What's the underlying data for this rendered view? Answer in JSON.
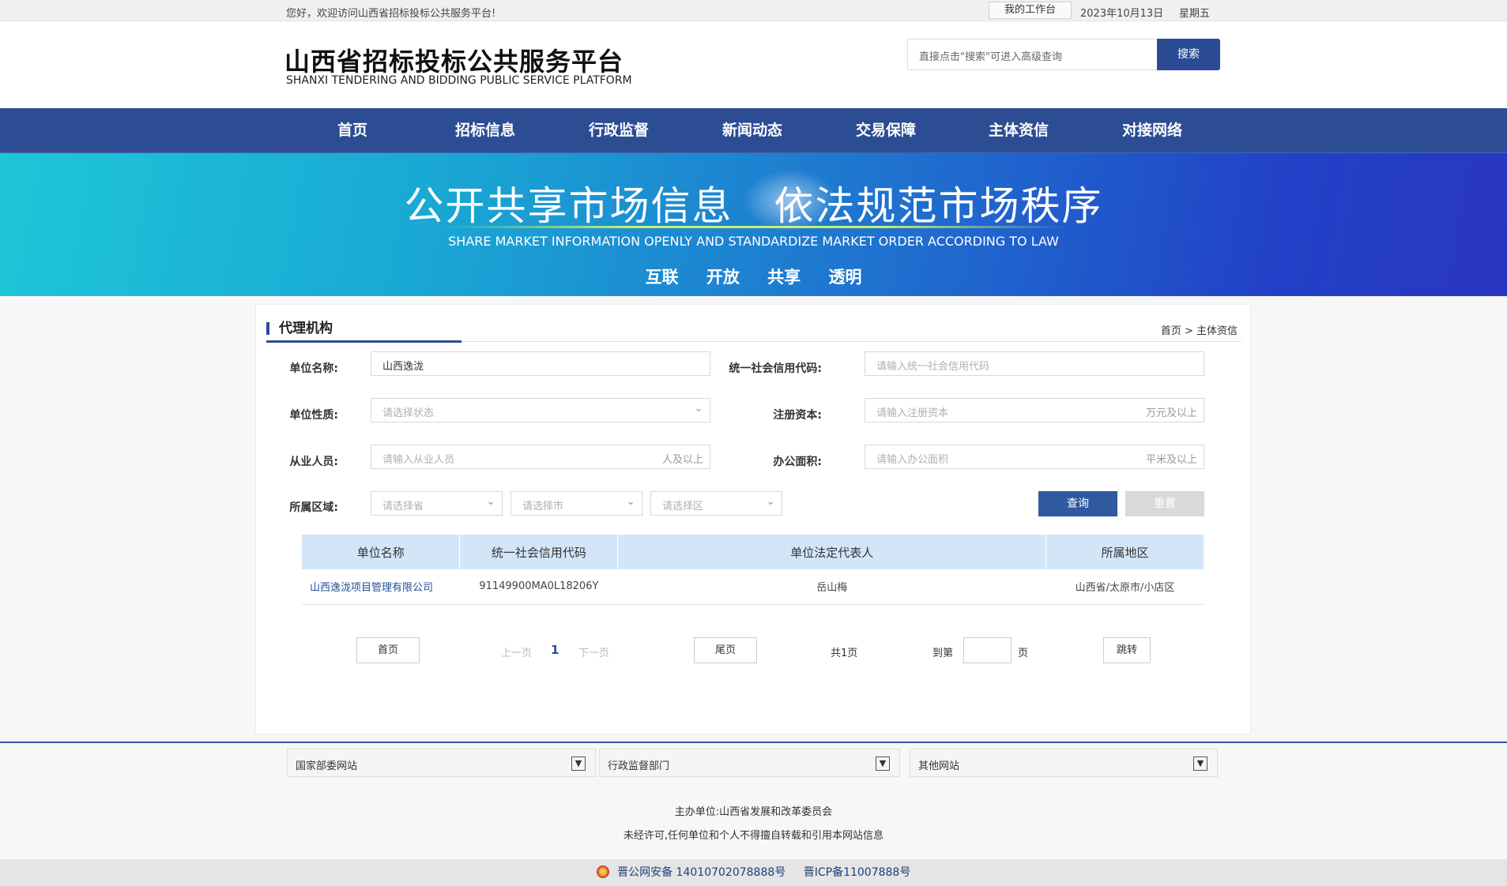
{
  "topbar": {
    "welcome": "您好，欢迎访问山西省招标投标公共服务平台!",
    "workbench": "我的工作台",
    "date": "2023年10月13日",
    "weekday": "星期五"
  },
  "header": {
    "logo_cn": "山西省招标投标公共服务平台",
    "logo_en": "SHANXI TENDERING AND BIDDING PUBLIC SERVICE PLATFORM",
    "search_placeholder": "直接点击\"搜索\"可进入高级查询",
    "search_button": "搜索"
  },
  "nav": [
    "首页",
    "招标信息",
    "行政监督",
    "新闻动态",
    "交易保障",
    "主体资信",
    "对接网络"
  ],
  "banner": {
    "slogan": "公开共享市场信息　依法规范市场秩序",
    "slogan_en": "SHARE MARKET INFORMATION OPENLY AND STANDARDIZE MARKET ORDER ACCORDING TO LAW",
    "tags": [
      "互联",
      "开放",
      "共享",
      "透明"
    ]
  },
  "panel": {
    "title": "代理机构",
    "breadcrumb": "首页 > 主体资信"
  },
  "form": {
    "unit_name_label": "单位名称:",
    "unit_name_value": "山西逸泷",
    "credit_code_label": "统一社会信用代码:",
    "credit_code_placeholder": "请输入统一社会信用代码",
    "nature_label": "单位性质:",
    "nature_placeholder": "请选择状态",
    "capital_label": "注册资本:",
    "capital_placeholder": "请输入注册资本",
    "capital_suffix": "万元及以上",
    "staff_label": "从业人员:",
    "staff_placeholder": "请输入从业人员",
    "staff_suffix": "人及以上",
    "area_label": "办公面积:",
    "area_placeholder": "请输入办公面积",
    "area_suffix": "平米及以上",
    "region_label": "所属区域:",
    "province_placeholder": "请选择省",
    "city_placeholder": "请选择市",
    "district_placeholder": "请选择区",
    "query_button": "查询",
    "reset_button": "重置"
  },
  "table": {
    "headers": [
      "单位名称",
      "统一社会信用代码",
      "单位法定代表人",
      "所属地区"
    ],
    "rows": [
      [
        "山西逸泷项目管理有限公司",
        "91149900MA0L18206Y",
        "岳山梅",
        "山西省/太原市/小店区"
      ]
    ]
  },
  "pagination": {
    "first": "首页",
    "prev": "上一页",
    "current": "1",
    "next": "下一页",
    "last": "尾页",
    "total": "共1页",
    "goto_label": "到第",
    "goto_unit": "页",
    "jump": "跳转"
  },
  "footer": {
    "selects": [
      "国家部委网站",
      "行政监督部门",
      "其他网站"
    ],
    "sponsor": "主办单位:山西省发展和改革委员会",
    "copyright": "未经许可,任何单位和个人不得擅自转载和引用本网站信息",
    "police_record": "晋公网安备 14010702078888号",
    "icp_record": "晋ICP备11007888号"
  }
}
